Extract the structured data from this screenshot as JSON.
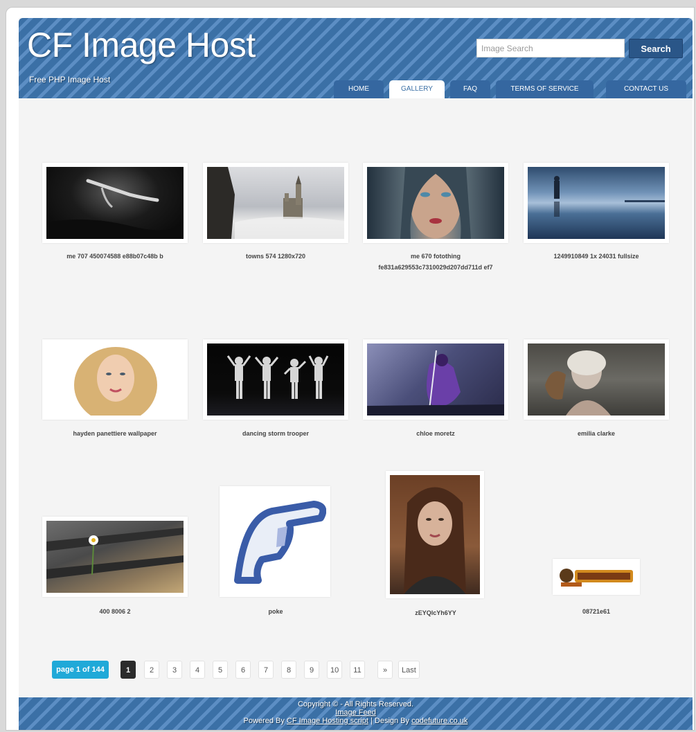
{
  "header": {
    "title": "CF Image Host",
    "tagline": "Free PHP Image Host",
    "search": {
      "placeholder": "Image Search",
      "button_label": "Search"
    }
  },
  "nav": {
    "tabs": [
      {
        "label": "HOME",
        "active": false
      },
      {
        "label": "GALLERY",
        "active": true
      },
      {
        "label": "FAQ",
        "active": false
      },
      {
        "label": "TERMS OF SERVICE",
        "active": false
      },
      {
        "label": "CONTACT US",
        "active": false
      }
    ]
  },
  "gallery": {
    "items": [
      {
        "caption": "me 707 450074588 e88b07c48b b",
        "scene": "swimmer underwater"
      },
      {
        "caption": "towns 574 1280x720",
        "scene": "castle in fog"
      },
      {
        "caption": "me 670 fotothing fe831a629553c7310029d207dd711d ef7",
        "scene": "hooded woman portrait"
      },
      {
        "caption": "1249910849 1x 24031 fullsize",
        "scene": "figure on reflective beach"
      },
      {
        "caption": "hayden panettiere wallpaper",
        "scene": "blonde woman portrait"
      },
      {
        "caption": "dancing storm trooper",
        "scene": "storm troopers dancing"
      },
      {
        "caption": "chloe moretz",
        "scene": "purple costumed heroine"
      },
      {
        "caption": "emilia clarke",
        "scene": "woman with dragon"
      },
      {
        "caption": "400 8006 2",
        "scene": "daisy on wooden planks"
      },
      {
        "caption": "poke",
        "scene": "pointing hand icon"
      },
      {
        "caption": "zEYQlcYh6YY",
        "scene": "young woman selfie"
      },
      {
        "caption": "08721e61",
        "scene": "small logo banner"
      }
    ]
  },
  "pagination": {
    "info": "page 1 of 144",
    "pages": [
      "1",
      "2",
      "3",
      "4",
      "5",
      "6",
      "7",
      "8",
      "9",
      "10",
      "11"
    ],
    "current": "1",
    "next": "»",
    "last": "Last"
  },
  "footer": {
    "copyright": "Copyright © - All Rights Reserved.",
    "feed_link": "Image Feed",
    "powered_prefix": "Powered By",
    "powered_link": "CF Image Hosting script",
    "design_prefix": "| Design By",
    "design_link": "codefuture.co.uk"
  },
  "colors": {
    "header_blue": "#3b70a6",
    "stripe_light": "#5c8ec4",
    "search_button": "#2a5688",
    "page_info": "#20a9d8",
    "current_page": "#2b2b2b"
  }
}
